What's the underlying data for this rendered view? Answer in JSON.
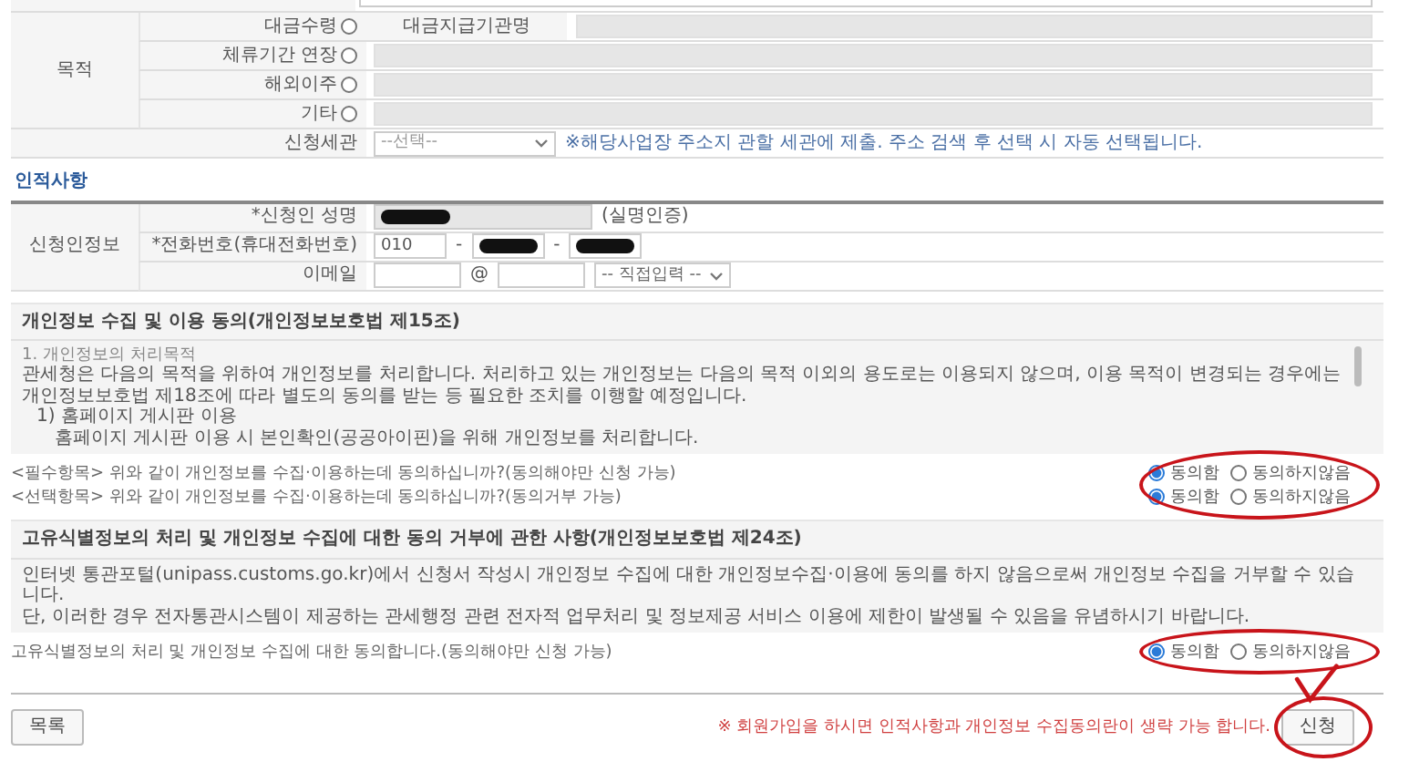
{
  "purpose": {
    "label": "목적",
    "options": [
      {
        "label": "대금수령",
        "selected": false,
        "field_label": "대금지급기관명"
      },
      {
        "label": "체류기간 연장",
        "selected": false
      },
      {
        "label": "해외이주",
        "selected": false
      },
      {
        "label": "기타",
        "selected": false
      }
    ]
  },
  "customs_office": {
    "label": "신청세관",
    "value": "--선택--",
    "note": "※해당사업장 주소지 관할 세관에 제출. 주소 검색 후 선택 시 자동 선택됩니다."
  },
  "personal": {
    "title": "인적사항",
    "group_label": "신청인정보",
    "name": {
      "label": "*신청인 성명",
      "note": "(실명인증)"
    },
    "phone": {
      "label": "*전화번호(휴대전화번호)",
      "prefix": "010",
      "separators": [
        "-",
        "-"
      ]
    },
    "email": {
      "label": "이메일",
      "at": "@",
      "domain": "-- 직접입력 --"
    }
  },
  "consents": [
    {
      "title": "개인정보 수집 및 이용 동의(개인정보보호법 제15조)",
      "scrollable": true,
      "body": [
        {
          "kind": "small",
          "text": "1. 개인정보의 처리목적"
        },
        {
          "kind": "para",
          "text": "관세청은 다음의 목적을 위하여 개인정보를 처리합니다. 처리하고 있는 개인정보는 다음의 목적 이외의 용도로는 이용되지 않으며, 이용 목적이 변경되는 경우에는 개인정보보호법 제18조에 따라 별도의 동의를 받는 등 필요한 조치를 이행할 예정입니다."
        },
        {
          "kind": "item",
          "text": "1) 홈페이지 게시판 이용"
        },
        {
          "kind": "subitem",
          "text": "홈페이지 게시판 이용 시 본인확인(공공아이핀)을 위해 개인정보를 처리합니다."
        }
      ],
      "questions": [
        {
          "text": "<필수항목> 위와 같이 개인정보를 수집·이용하는데 동의하십니까?(동의해야만 신청 가능)",
          "options": [
            {
              "label": "동의함",
              "selected": true
            },
            {
              "label": "동의하지않음",
              "selected": false
            }
          ]
        },
        {
          "text": "<선택항목> 위와 같이 개인정보를 수집·이용하는데 동의하십니까?(동의거부 가능)",
          "options": [
            {
              "label": "동의함",
              "selected": true
            },
            {
              "label": "동의하지않음",
              "selected": false
            }
          ]
        }
      ],
      "circled": true
    },
    {
      "title": "고유식별정보의 처리 및 개인정보 수집에 대한 동의 거부에 관한 사항(개인정보보호법 제24조)",
      "scrollable": false,
      "body": [
        {
          "kind": "para",
          "text": "인터넷 통관포털(unipass.customs.go.kr)에서 신청서 작성시 개인정보 수집에 대한 개인정보수집·이용에 동의를 하지 않음으로써 개인정보 수집을 거부할 수 있습니다."
        },
        {
          "kind": "para",
          "text": "단, 이러한 경우 전자통관시스템이 제공하는 관세행정 관련 전자적 업무처리 및 정보제공 서비스 이용에 제한이 발생될 수 있음을 유념하시기 바랍니다."
        }
      ],
      "questions": [
        {
          "text": "고유식별정보의 처리 및 개인정보 수집에 대한 동의합니다.(동의해야만 신청 가능)",
          "options": [
            {
              "label": "동의함",
              "selected": true
            },
            {
              "label": "동의하지않음",
              "selected": false
            }
          ]
        }
      ],
      "circled": true
    }
  ],
  "footer": {
    "list_button": "목록",
    "notice": "※ 회원가입을 하시면 인적사항과 개인정보 수집동의란이 생략 가능 합니다.",
    "submit_button": "신청",
    "submit_circled": true,
    "checkmark": true
  }
}
